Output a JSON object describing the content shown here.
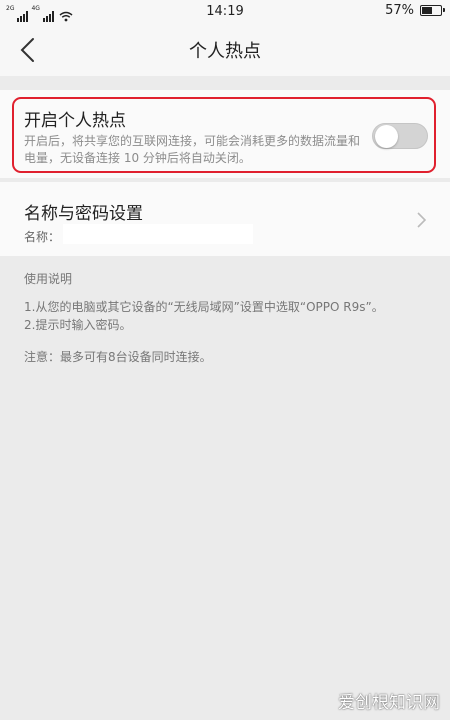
{
  "status_bar": {
    "network_left": "2G",
    "network_right": "4G",
    "time": "14:19",
    "battery": "57%",
    "battery_level": 0.57
  },
  "nav": {
    "title": "个人热点"
  },
  "hotspot": {
    "title": "开启个人热点",
    "description": "开启后，将共享您的互联网连接，可能会消耗更多的数据流量和电量，无设备连接 10 分钟后将自动关闭。",
    "enabled": false
  },
  "name_password": {
    "title": "名称与密码设置",
    "name_label": "名称：",
    "name_value": ""
  },
  "instructions": {
    "header": "使用说明",
    "step1": "1.从您的电脑或其它设备的“无线局域网”设置中选取“OPPO R9s”。",
    "step2": "2.提示时输入密码。",
    "note": "注意：最多可有8台设备同时连接。"
  },
  "watermark": "爱创根知识网",
  "colors": {
    "background": "#ebebeb",
    "card": "#fafafa",
    "highlight": "#e0202e",
    "toggle_off": "#d4d4d4"
  }
}
